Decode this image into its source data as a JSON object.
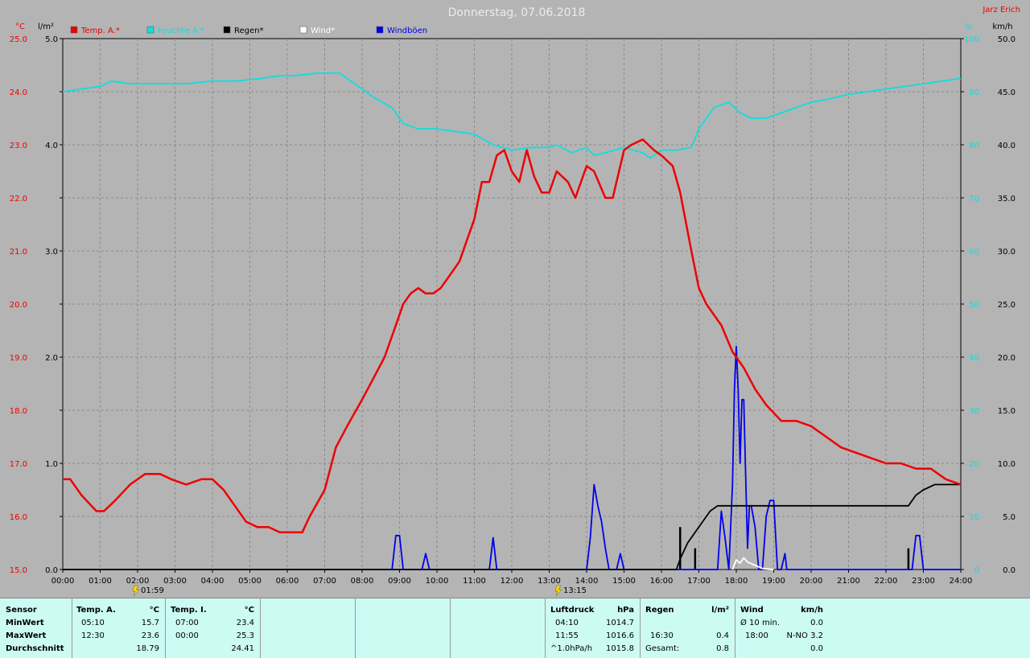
{
  "header": {
    "title": "Donnerstag, 07.06.2018",
    "author": "Jarz Erich",
    "unit_temp": "°C",
    "unit_rain": "l/m²",
    "unit_humidity": "%",
    "unit_wind": "km/h"
  },
  "legend": [
    {
      "label": "Temp. A.*",
      "color": "#ee0000"
    },
    {
      "label": "Feuchte A.*",
      "color": "#11dddd"
    },
    {
      "label": "Regen*",
      "color": "#000000"
    },
    {
      "label": "Wind*",
      "color": "#ffffff"
    },
    {
      "label": "Windböen",
      "color": "#0000ee"
    }
  ],
  "markers": [
    {
      "label": "01:59"
    },
    {
      "label": "13:15"
    }
  ],
  "chart_data": {
    "type": "line",
    "title": "Donnerstag, 07.06.2018",
    "x_ticks": [
      "00:00",
      "01:00",
      "02:00",
      "03:00",
      "04:00",
      "05:00",
      "06:00",
      "07:00",
      "08:00",
      "09:00",
      "10:00",
      "11:00",
      "12:00",
      "13:00",
      "14:00",
      "15:00",
      "16:00",
      "17:00",
      "18:00",
      "19:00",
      "20:00",
      "21:00",
      "22:00",
      "23:00",
      "24:00"
    ],
    "xlim": [
      0,
      24
    ],
    "axes": {
      "temp": {
        "label": "°C",
        "range": [
          15,
          25
        ],
        "ticks": [
          "15.0",
          "16.0",
          "17.0",
          "18.0",
          "19.0",
          "20.0",
          "21.0",
          "22.0",
          "23.0",
          "24.0",
          "25.0"
        ]
      },
      "rain": {
        "label": "l/m²",
        "range": [
          0,
          5
        ],
        "ticks": [
          "0.0",
          "1.0",
          "2.0",
          "3.0",
          "4.0",
          "5.0"
        ]
      },
      "humidity": {
        "label": "%",
        "range": [
          0,
          100
        ],
        "ticks": [
          "0",
          "10",
          "20",
          "30",
          "40",
          "50",
          "60",
          "70",
          "80",
          "90",
          "100"
        ]
      },
      "wind": {
        "label": "km/h",
        "range": [
          0,
          50
        ],
        "ticks": [
          "0.0",
          "5.0",
          "10.0",
          "15.0",
          "20.0",
          "25.0",
          "30.0",
          "35.0",
          "40.0",
          "45.0",
          "50.0"
        ]
      }
    },
    "series": [
      {
        "name": "Temp. A.*",
        "axis": "temp",
        "color": "#ee0000",
        "x": [
          0,
          0.2,
          0.5,
          0.9,
          1.1,
          1.4,
          1.8,
          2.2,
          2.4,
          2.6,
          2.9,
          3.3,
          3.7,
          4.0,
          4.3,
          4.6,
          4.9,
          5.2,
          5.5,
          5.8,
          6.1,
          6.4,
          6.6,
          7.0,
          7.3,
          7.6,
          8.0,
          8.3,
          8.6,
          8.9,
          9.1,
          9.3,
          9.5,
          9.7,
          9.9,
          10.1,
          10.3,
          10.6,
          10.8,
          11.0,
          11.2,
          11.4,
          11.6,
          11.8,
          12.0,
          12.2,
          12.4,
          12.6,
          12.8,
          13.0,
          13.2,
          13.5,
          13.7,
          14.0,
          14.2,
          14.5,
          14.7,
          15.0,
          15.2,
          15.5,
          15.8,
          16.0,
          16.3,
          16.5,
          16.8,
          17.0,
          17.2,
          17.6,
          17.9,
          18.2,
          18.5,
          18.8,
          19.2,
          19.6,
          20.0,
          20.4,
          20.8,
          21.2,
          21.6,
          22.0,
          22.4,
          22.8,
          23.2,
          23.6,
          24.0
        ],
        "y": [
          16.7,
          16.7,
          16.4,
          16.1,
          16.1,
          16.3,
          16.6,
          16.8,
          16.8,
          16.8,
          16.7,
          16.6,
          16.7,
          16.7,
          16.5,
          16.2,
          15.9,
          15.8,
          15.8,
          15.7,
          15.7,
          15.7,
          16.0,
          16.5,
          17.3,
          17.7,
          18.2,
          18.6,
          19.0,
          19.6,
          20.0,
          20.2,
          20.3,
          20.2,
          20.2,
          20.3,
          20.5,
          20.8,
          21.2,
          21.6,
          22.3,
          22.3,
          22.8,
          22.9,
          22.5,
          22.3,
          22.9,
          22.4,
          22.1,
          22.1,
          22.5,
          22.3,
          22.0,
          22.6,
          22.5,
          22.0,
          22.0,
          22.9,
          23.0,
          23.1,
          22.9,
          22.8,
          22.6,
          22.1,
          21.0,
          20.3,
          20.0,
          19.6,
          19.1,
          18.8,
          18.4,
          18.1,
          17.8,
          17.8,
          17.7,
          17.5,
          17.3,
          17.2,
          17.1,
          17.0,
          17.0,
          16.9,
          16.9,
          16.7,
          16.6
        ]
      },
      {
        "name": "Feuchte A.*",
        "axis": "humidity",
        "color": "#11dddd",
        "x": [
          0,
          0.5,
          1.0,
          1.3,
          1.8,
          2.5,
          3.3,
          4.0,
          4.6,
          5.3,
          5.8,
          6.2,
          6.8,
          7.0,
          7.4,
          7.8,
          8.3,
          8.8,
          9.1,
          9.5,
          10.0,
          10.5,
          11.0,
          11.5,
          12.0,
          12.5,
          13.0,
          13.2,
          13.6,
          14.0,
          14.2,
          14.5,
          15.0,
          15.5,
          15.7,
          16.0,
          16.4,
          16.8,
          17.0,
          17.4,
          17.8,
          18.1,
          18.4,
          18.8,
          19.4,
          20.0,
          20.4,
          21.0,
          21.5,
          22.0,
          22.5,
          23.0,
          23.5,
          24.0
        ],
        "y": [
          90,
          90.5,
          91,
          92,
          91.5,
          91.5,
          91.5,
          92,
          92,
          92.5,
          93,
          93,
          93.5,
          93.5,
          93.5,
          91.5,
          89,
          87,
          84,
          83,
          83,
          82.5,
          82,
          80,
          79,
          79.5,
          79.5,
          80,
          78.5,
          79.5,
          78,
          78.5,
          79.5,
          78.5,
          77.5,
          79,
          79,
          79.5,
          83,
          87,
          88,
          86,
          85,
          85,
          86.5,
          88,
          88.5,
          89.5,
          90,
          90.5,
          91,
          91.5,
          92,
          92.5
        ]
      },
      {
        "name": "Regen*",
        "axis": "rain",
        "color": "#000000",
        "x": [
          0,
          16.4,
          16.5,
          16.7,
          16.9,
          17.1,
          17.3,
          17.5,
          17.8,
          18.0,
          19.0,
          20.0,
          21.0,
          22.0,
          22.6,
          22.8,
          23.0,
          23.3,
          23.6,
          24.0
        ],
        "y": [
          0,
          0,
          0.1,
          0.25,
          0.35,
          0.45,
          0.55,
          0.6,
          0.6,
          0.6,
          0.6,
          0.6,
          0.6,
          0.6,
          0.6,
          0.7,
          0.75,
          0.8,
          0.8,
          0.8
        ]
      },
      {
        "name": "Wind*",
        "axis": "wind",
        "color": "#ffffff",
        "x": [
          17.9,
          18.0,
          18.1,
          18.2,
          18.3,
          18.5,
          18.7,
          19.0
        ],
        "y": [
          0,
          0.9,
          0.6,
          1.1,
          0.7,
          0.4,
          0.1,
          0
        ]
      },
      {
        "name": "Windböen",
        "axis": "wind",
        "color": "#0000ee",
        "x": [
          0,
          8.8,
          8.9,
          9.0,
          9.1,
          9.6,
          9.7,
          9.8,
          11.4,
          11.5,
          11.6,
          14.0,
          14.1,
          14.2,
          14.3,
          14.4,
          14.5,
          14.6,
          14.8,
          14.9,
          15.0,
          17.5,
          17.6,
          17.7,
          17.8,
          17.9,
          17.95,
          18.0,
          18.05,
          18.1,
          18.15,
          18.2,
          18.25,
          18.3,
          18.35,
          18.4,
          18.5,
          18.55,
          18.6,
          18.7,
          18.8,
          18.9,
          19.0,
          19.1,
          19.2,
          19.3,
          19.35,
          19.4,
          19.5,
          22.7,
          22.8,
          22.9,
          23.0,
          24.0
        ],
        "y": [
          0,
          0,
          3.2,
          3.2,
          0,
          0,
          1.5,
          0,
          0,
          3.0,
          0,
          0,
          3.0,
          8.0,
          6.0,
          4.5,
          2.0,
          0,
          0,
          1.5,
          0,
          0,
          5.5,
          3.0,
          0,
          8.0,
          17.0,
          21.0,
          17.0,
          10.0,
          16.0,
          16.0,
          9.0,
          2.0,
          6.0,
          6.0,
          4.0,
          2.0,
          0,
          0,
          5.0,
          6.5,
          6.5,
          0,
          0,
          1.5,
          0,
          0,
          0,
          0,
          3.2,
          3.2,
          0,
          0
        ]
      }
    ],
    "rain_bars": [
      {
        "x": 16.5,
        "value": 0.4
      },
      {
        "x": 16.9,
        "value": 0.2
      },
      {
        "x": 22.6,
        "value": 0.2
      }
    ],
    "grid": true
  },
  "stats": {
    "sensor": {
      "header": "Sensor",
      "rows": [
        "MinWert",
        "MaxWert",
        "Durchschnitt"
      ]
    },
    "temp_a": {
      "header": "Temp. A.",
      "unit": "°C",
      "min_time": "05:10",
      "min": "15.7",
      "max_time": "12:30",
      "max": "23.6",
      "avg": "18.79"
    },
    "temp_i": {
      "header": "Temp. I.",
      "unit": "°C",
      "min_time": "07:00",
      "min": "23.4",
      "max_time": "00:00",
      "max": "25.3",
      "avg": "24.41"
    },
    "pressure": {
      "header": "Luftdruck",
      "unit": "hPa",
      "min_time": "04:10",
      "min": "1014.7",
      "max_time": "11:55",
      "max": "1016.6",
      "trend_label": "^1.0hPa/h",
      "trend": "1015.8"
    },
    "rain": {
      "header": "Regen",
      "unit": "l/m²",
      "max_time": "16:30",
      "max": "0.4",
      "total_label": "Gesamt:",
      "total": "0.8"
    },
    "wind": {
      "header": "Wind",
      "unit": "km/h",
      "avg_label": "Ø 10 min.",
      "avg": "0.0",
      "max_time": "18:00",
      "max": "N-NO 3.2",
      "last": "0.0"
    }
  }
}
